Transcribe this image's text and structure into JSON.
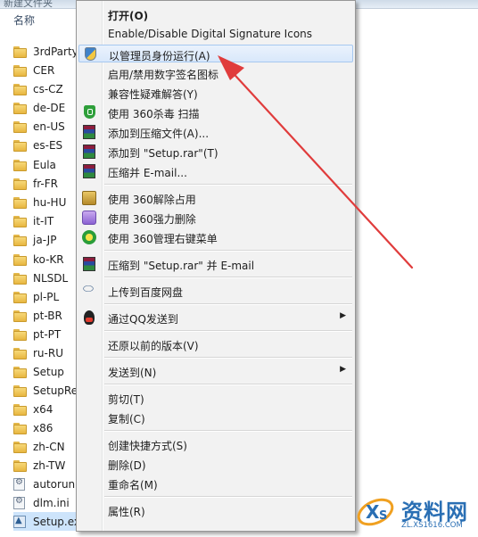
{
  "window": {
    "title_partial": "新建文件夹"
  },
  "columns": {
    "name_header": "名称"
  },
  "files": [
    {
      "name": "3rdParty",
      "type": "folder"
    },
    {
      "name": "CER",
      "type": "folder"
    },
    {
      "name": "cs-CZ",
      "type": "folder"
    },
    {
      "name": "de-DE",
      "type": "folder"
    },
    {
      "name": "en-US",
      "type": "folder"
    },
    {
      "name": "es-ES",
      "type": "folder"
    },
    {
      "name": "Eula",
      "type": "folder"
    },
    {
      "name": "fr-FR",
      "type": "folder"
    },
    {
      "name": "hu-HU",
      "type": "folder"
    },
    {
      "name": "it-IT",
      "type": "folder"
    },
    {
      "name": "ja-JP",
      "type": "folder"
    },
    {
      "name": "ko-KR",
      "type": "folder"
    },
    {
      "name": "NLSDL",
      "type": "folder"
    },
    {
      "name": "pl-PL",
      "type": "folder"
    },
    {
      "name": "pt-BR",
      "type": "folder"
    },
    {
      "name": "pt-PT",
      "type": "folder"
    },
    {
      "name": "ru-RU",
      "type": "folder"
    },
    {
      "name": "Setup",
      "type": "folder"
    },
    {
      "name": "SetupRe",
      "type": "folder"
    },
    {
      "name": "x64",
      "type": "folder"
    },
    {
      "name": "x86",
      "type": "folder"
    },
    {
      "name": "zh-CN",
      "type": "folder"
    },
    {
      "name": "zh-TW",
      "type": "folder"
    },
    {
      "name": "autorun.",
      "type": "config"
    },
    {
      "name": "dlm.ini",
      "type": "config"
    },
    {
      "name": "Setup.exe",
      "type": "exe"
    }
  ],
  "menu": {
    "items": [
      {
        "label": "打开(O)",
        "icon": "",
        "bold": true
      },
      {
        "label": "Enable/Disable Digital Signature Icons",
        "icon": ""
      },
      {
        "label": "以管理员身份运行(A)",
        "icon": "uac-shield-icon",
        "highlighted": true
      },
      {
        "label": "启用/禁用数字签名图标",
        "icon": ""
      },
      {
        "label": "兼容性疑难解答(Y)",
        "icon": ""
      },
      {
        "label": "使用 360杀毒 扫描",
        "icon": "shield-360-icon"
      },
      {
        "label": "添加到压缩文件(A)...",
        "icon": "winrar-icon"
      },
      {
        "label": "添加到 \"Setup.rar\"(T)",
        "icon": "winrar-icon"
      },
      {
        "label": "压缩并 E-mail...",
        "icon": "winrar-icon"
      },
      {
        "label": "使用 360解除占用",
        "icon": "unlock-icon"
      },
      {
        "label": "使用 360强力删除",
        "icon": "force-delete-icon"
      },
      {
        "label": "使用 360管理右键菜单",
        "icon": "menu-manager-icon"
      },
      {
        "label": "压缩到 \"Setup.rar\" 并 E-mail",
        "icon": "winrar-icon"
      },
      {
        "label": "上传到百度网盘",
        "icon": "baidu-cloud-icon"
      },
      {
        "label": "通过QQ发送到",
        "icon": "qq-icon",
        "submenu": true
      },
      {
        "label": "还原以前的版本(V)",
        "icon": ""
      },
      {
        "label": "发送到(N)",
        "icon": "",
        "submenu": true
      },
      {
        "label": "剪切(T)",
        "icon": ""
      },
      {
        "label": "复制(C)",
        "icon": ""
      },
      {
        "label": "创建快捷方式(S)",
        "icon": ""
      },
      {
        "label": "删除(D)",
        "icon": ""
      },
      {
        "label": "重命名(M)",
        "icon": ""
      },
      {
        "label": "属性(R)",
        "icon": ""
      }
    ]
  },
  "watermark": {
    "brand": "资料网",
    "url": "ZL.XS1616.COM"
  },
  "colors": {
    "highlight": "#d9e8fb",
    "arrow": "#e03c3c",
    "menu_bg": "#f2f2f2",
    "brand": "#2a6fb4"
  }
}
